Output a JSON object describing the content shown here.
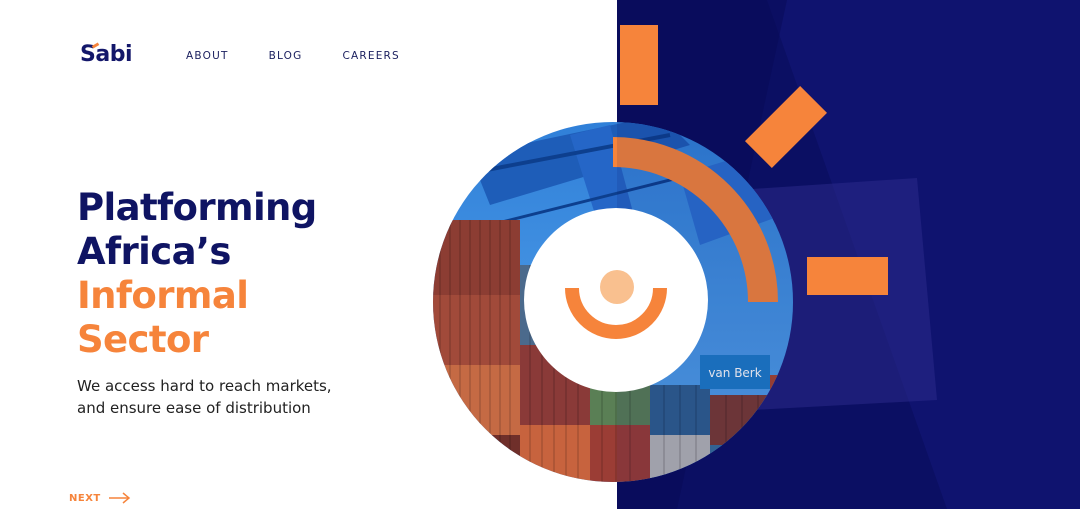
{
  "brand": {
    "logo_text": "Sabi"
  },
  "nav": {
    "items": [
      {
        "label": "ABOUT"
      },
      {
        "label": "BLOG"
      },
      {
        "label": "CAREERS"
      }
    ]
  },
  "hero": {
    "title_line1": "Platforming",
    "title_line2": "Africa’s",
    "title_line3": "Informal",
    "title_line4": "Sector",
    "subtitle_line1": "We access hard to reach markets,",
    "subtitle_line2": "and ensure ease of distribution",
    "container_text": "van Berk"
  },
  "footer": {
    "next_label": "NEXT",
    "next_icon": "arrow-right-icon"
  },
  "colors": {
    "navy": "#0b0f63",
    "orange": "#f6843b",
    "peach": "#f9c08f",
    "title_dark": "#0f1463"
  }
}
